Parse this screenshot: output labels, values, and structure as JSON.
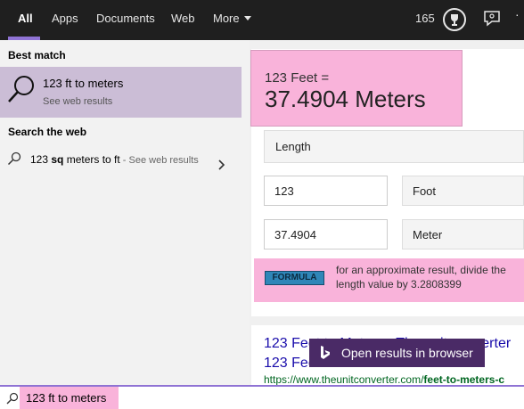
{
  "tabs": [
    {
      "label": "All",
      "active": true
    },
    {
      "label": "Apps"
    },
    {
      "label": "Documents"
    },
    {
      "label": "Web"
    },
    {
      "label": "More"
    }
  ],
  "header": {
    "points": "165",
    "trophy_icon": "trophy-icon",
    "feedback_icon": "feedback-icon",
    "more_icon": "ellipsis-icon"
  },
  "sections": {
    "best_match": "Best match",
    "search_web": "Search the web"
  },
  "best_match": {
    "title": "123 ft to meters",
    "subtitle": "See web results",
    "icon": "search-icon"
  },
  "web_suggestion": {
    "prefix": "123 ",
    "bold": "sq",
    "rest": " meters to ft",
    "suffix": " - See web results"
  },
  "converter": {
    "answer_small": "123 Feet =",
    "answer_big": "37.4904 Meters",
    "category": "Length",
    "from_value": "123",
    "from_unit": "Foot",
    "to_value": "37.4904",
    "to_unit": "Meter",
    "formula_badge": "FORMULA",
    "formula_text": "for an approximate result, divide the length value by 3.2808399"
  },
  "web_result": {
    "title_line1": "123 Feet to Meters - The unit converter",
    "title_line2": "123 Feet to Meters ...",
    "url_prefix": "https://www.theunitconverter.com/",
    "url_bold": "feet-to-meters-c"
  },
  "open_button": {
    "label": "Open results in browser",
    "icon": "bing-icon"
  },
  "search": {
    "value": "123 ft to meters"
  },
  "colors": {
    "accent": "#8f73d4",
    "highlight": "#f9b3da",
    "selected": "#cbbdd6",
    "button": "#4a2a66"
  }
}
